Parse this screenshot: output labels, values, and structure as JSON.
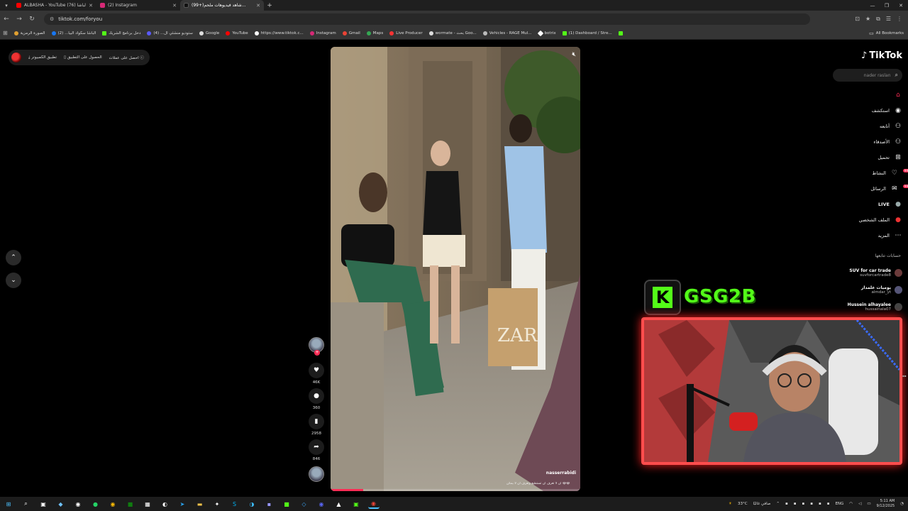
{
  "browser": {
    "tabs": [
      {
        "title": "ALBASHA - YouTube الباشا (76)",
        "color": "#ff0000",
        "active": false
      },
      {
        "title": "(2) Instagram",
        "color": "#d62976",
        "active": false
      },
      {
        "title": "(99+)شاهد فيديوهات ملحم...",
        "color": "#000000",
        "active": true
      }
    ],
    "url": "tiktok.com/foryou",
    "bookmarks": [
      {
        "label": "الصورة الرمزية",
        "color": "#e0a030"
      },
      {
        "label": "الباشا سكواد البيا... (2)",
        "color": "#1877f2"
      },
      {
        "label": "دخل برنامج الشريك",
        "color": "#53fc18"
      },
      {
        "label": "ستوديو منشئي ال... (4)",
        "color": "#5a5aff"
      },
      {
        "label": "Google",
        "color": "#dddddd"
      },
      {
        "label": "YouTube",
        "color": "#ff0000"
      },
      {
        "label": "https://www.tiktok.c...",
        "color": "#ffffff"
      },
      {
        "label": "Instagram",
        "color": "#d62976"
      },
      {
        "label": "Gmail",
        "color": "#ea4335"
      },
      {
        "label": "Maps",
        "color": "#34a853"
      },
      {
        "label": "Live Producer",
        "color": "#ff3333"
      },
      {
        "label": "wormate - بحث Goo...",
        "color": "#dddddd"
      },
      {
        "label": "Vehicles - RAGE Mul...",
        "color": "#bbbbbb"
      },
      {
        "label": "botrix",
        "color": "#ffffff"
      },
      {
        "label": "(1) Dashboard / Stre...",
        "color": "#53fc18"
      },
      {
        "label": "",
        "color": "#53fc18"
      }
    ],
    "all_bookmarks": "All Bookmarks"
  },
  "top_pill": {
    "coins": "احصل على عملات",
    "get_app": "الحصول على التطبيق",
    "desktop_app": "تطبيق الكمبيوتر"
  },
  "actions": {
    "likes": "46K",
    "comments": "360",
    "saves": "2958",
    "shares": "846"
  },
  "video": {
    "creator": "nasserrabidi",
    "caption": "أن لا تعرف أن تستطيع وتعرف أن لا يمكن 😂😂"
  },
  "sidebar": {
    "logo": "TikTok",
    "search_placeholder": "nader raslan",
    "menu": [
      {
        "label": "",
        "icon": "home-icon",
        "glyph": "⌂",
        "active": true,
        "badge": ""
      },
      {
        "label": "استكشف",
        "icon": "compass-icon",
        "glyph": "◉",
        "active": false,
        "badge": ""
      },
      {
        "label": "أتابعه",
        "icon": "following-icon",
        "glyph": "⚇",
        "active": false,
        "badge": ""
      },
      {
        "label": "الأصدقاء",
        "icon": "friends-icon",
        "glyph": "⚇",
        "active": false,
        "badge": ""
      },
      {
        "label": "تحميل",
        "icon": "upload-icon",
        "glyph": "⊞",
        "active": false,
        "badge": ""
      },
      {
        "label": "النشاط",
        "icon": "activity-icon",
        "glyph": "♡",
        "active": false,
        "badge": "99"
      },
      {
        "label": "الرسائل",
        "icon": "messages-icon",
        "glyph": "✉",
        "active": false,
        "badge": "99"
      },
      {
        "label": "LIVE",
        "icon": "live-icon",
        "glyph": "●",
        "active": false,
        "badge": ""
      },
      {
        "label": "الملف الشخصي",
        "icon": "profile-icon",
        "glyph": "●",
        "active": false,
        "badge": ""
      },
      {
        "label": "المزيد",
        "icon": "more-icon",
        "glyph": "⋯",
        "active": false,
        "badge": ""
      }
    ],
    "following_title": "حسابات تتابعها",
    "following": [
      {
        "name": "SUV for car trade",
        "user": "suvforcartrade8"
      },
      {
        "name": "يوميات علمدار",
        "user": "almdar_yt"
      },
      {
        "name": "Hussein alhayalee",
        "user": "hussainala07"
      }
    ]
  },
  "overlay": {
    "logo_letter": "K",
    "name": "GSG2B",
    "accent": "#53fc18"
  },
  "taskbar": {
    "weather": "33°C",
    "weather_text": "صافي غالبًا",
    "lang": "ENG",
    "time": "5:11 AM",
    "date": "9/12/2025"
  }
}
